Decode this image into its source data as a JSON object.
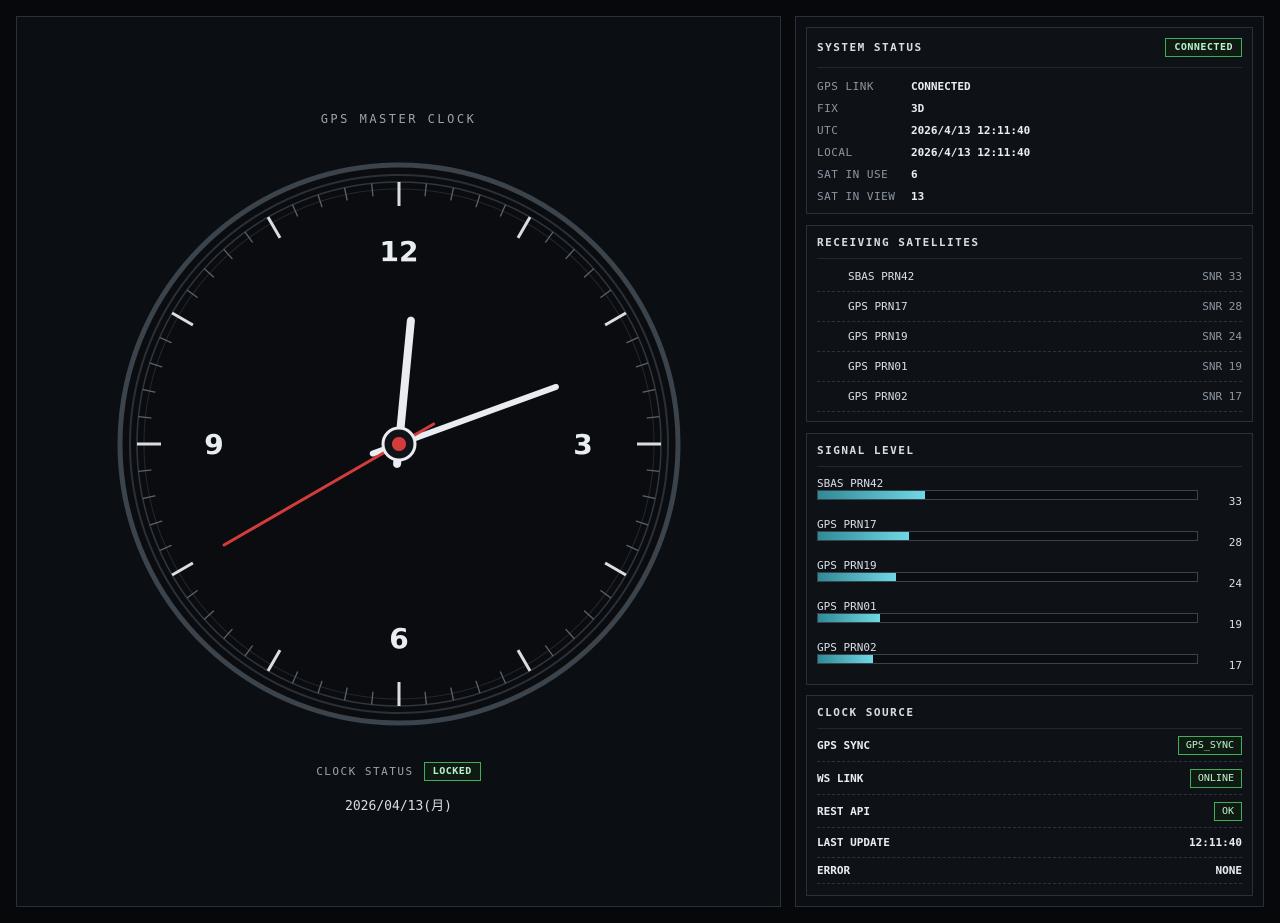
{
  "clock": {
    "title": "GPS MASTER CLOCK",
    "numerals": {
      "n12": "12",
      "n3": "3",
      "n6": "6",
      "n9": "9"
    },
    "time": {
      "hours": 12,
      "minutes": 11,
      "seconds": 40
    },
    "status_label": "CLOCK STATUS",
    "status_value": "LOCKED",
    "date": "2026/04/13(月)",
    "colors": {
      "second_hand": "#d43c3c",
      "hands": "#e9edf1",
      "center_dot": "#d43c3c"
    }
  },
  "system_status": {
    "title": "SYSTEM STATUS",
    "badge": "CONNECTED",
    "rows": [
      {
        "k": "GPS LINK",
        "v": "CONNECTED"
      },
      {
        "k": "FIX",
        "v": "3D"
      },
      {
        "k": "UTC",
        "v": "2026/4/13 12:11:40"
      },
      {
        "k": "LOCAL",
        "v": "2026/4/13 12:11:40"
      },
      {
        "k": "SAT IN USE",
        "v": "6"
      },
      {
        "k": "SAT IN VIEW",
        "v": "13"
      }
    ]
  },
  "satellites": {
    "title": "RECEIVING SATELLITES",
    "items": [
      {
        "name": "SBAS PRN42",
        "snr": "SNR 33"
      },
      {
        "name": "GPS PRN17",
        "snr": "SNR 28"
      },
      {
        "name": "GPS PRN19",
        "snr": "SNR 24"
      },
      {
        "name": "GPS PRN01",
        "snr": "SNR 19"
      },
      {
        "name": "GPS PRN02",
        "snr": "SNR 17"
      }
    ]
  },
  "signal": {
    "title": "SIGNAL LEVEL",
    "max": 117,
    "items": [
      {
        "name": "SBAS PRN42",
        "value": "33"
      },
      {
        "name": "GPS PRN17",
        "value": "28"
      },
      {
        "name": "GPS PRN19",
        "value": "24"
      },
      {
        "name": "GPS PRN01",
        "value": "19"
      },
      {
        "name": "GPS PRN02",
        "value": "17"
      }
    ]
  },
  "clock_source": {
    "title": "CLOCK SOURCE",
    "rows": [
      {
        "k": "GPS SYNC",
        "v": "GPS_SYNC",
        "badge": true
      },
      {
        "k": "WS LINK",
        "v": "ONLINE",
        "badge": true
      },
      {
        "k": "REST API",
        "v": "OK",
        "badge": true
      },
      {
        "k": "LAST UPDATE",
        "v": "12:11:40",
        "badge": false
      },
      {
        "k": "ERROR",
        "v": "NONE",
        "badge": false
      }
    ]
  }
}
